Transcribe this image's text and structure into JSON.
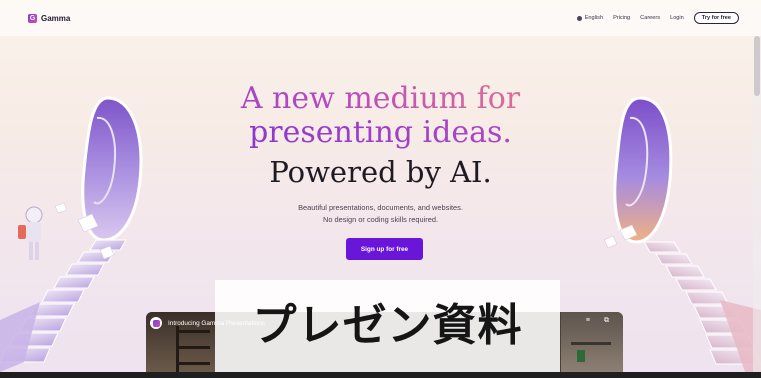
{
  "nav": {
    "brand": "Gamma",
    "language": "English",
    "links": [
      "Pricing",
      "Careers",
      "Login"
    ],
    "cta": "Try for free"
  },
  "hero": {
    "line1": "A new medium for",
    "line2": "presenting ideas.",
    "line3": "Powered by AI.",
    "sub1": "Beautiful presentations, documents, and websites.",
    "sub2": "No design or coding skills required.",
    "signup": "Sign up for free"
  },
  "video": {
    "title": "Introducing Gamma Presentations"
  },
  "overlay": {
    "text": "プレゼン資料"
  },
  "colors": {
    "accent": "#6a16d8",
    "gradient_start": "#7a37d4",
    "gradient_end": "#eb9a62"
  }
}
